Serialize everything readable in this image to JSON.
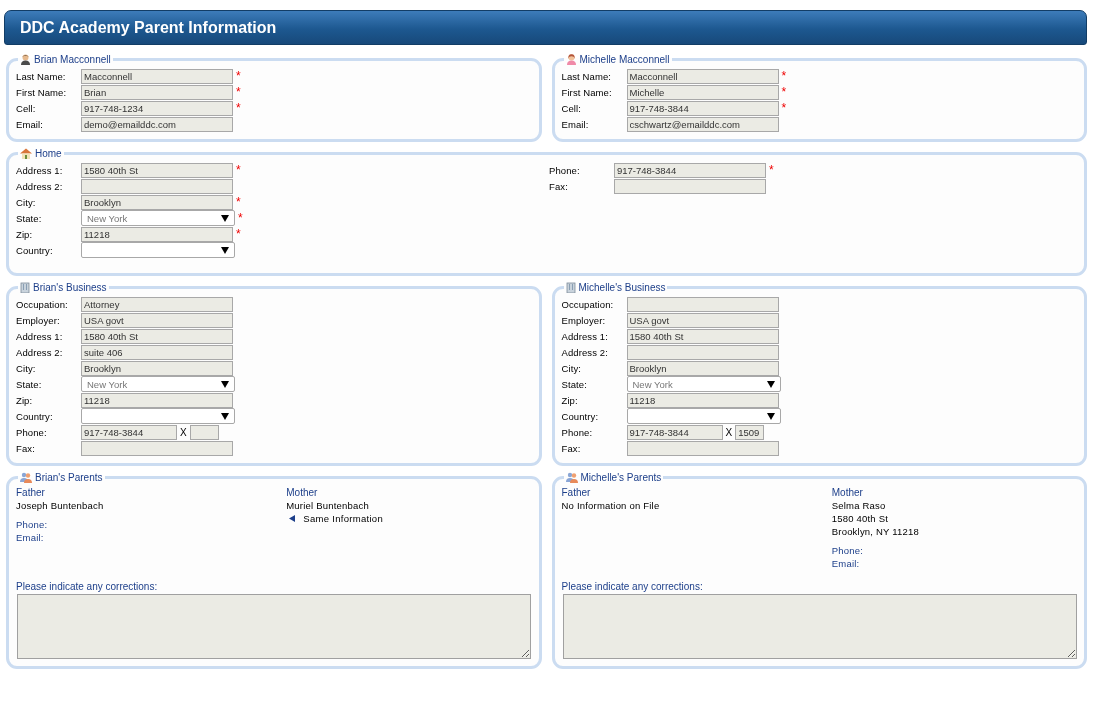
{
  "header": {
    "title": "DDC Academy Parent Information"
  },
  "people": [
    {
      "title": "Brian Macconnell",
      "fields": [
        {
          "kind": "text",
          "label": "Last Name:",
          "value": "Macconnell",
          "required_mark": "*"
        },
        {
          "kind": "text",
          "label": "First Name:",
          "value": "Brian",
          "required_mark": "*"
        },
        {
          "kind": "text",
          "label": "Cell:",
          "value": "917-748-1234",
          "required_mark": "*"
        },
        {
          "kind": "text",
          "label": "Email:",
          "value": "demo@emailddc.com"
        }
      ]
    },
    {
      "title": "Michelle Macconnell",
      "fields": [
        {
          "kind": "text",
          "label": "Last Name:",
          "value": "Macconnell",
          "required_mark": "*"
        },
        {
          "kind": "text",
          "label": "First Name:",
          "value": "Michelle",
          "required_mark": "*"
        },
        {
          "kind": "text",
          "label": "Cell:",
          "value": "917-748-3844",
          "required_mark": "*"
        },
        {
          "kind": "text",
          "label": "Email:",
          "value": "cschwartz@emailddc.com"
        }
      ]
    }
  ],
  "home": {
    "title": "Home",
    "left_fields": [
      {
        "kind": "text",
        "label": "Address 1:",
        "value": "1580 40th St",
        "required_mark": "*"
      },
      {
        "kind": "text",
        "label": "Address 2:"
      },
      {
        "kind": "text",
        "label": "City:",
        "value": "Brooklyn",
        "required_mark": "*"
      },
      {
        "kind": "select",
        "label": "State:",
        "value": "New York",
        "required_mark": "*"
      },
      {
        "kind": "text",
        "label": "Zip:",
        "value": "11218",
        "required_mark": "*"
      },
      {
        "kind": "select",
        "label": "Country:"
      }
    ],
    "right_fields": [
      {
        "kind": "text",
        "label": "Phone:",
        "value": "917-748-3844",
        "required_mark": "*"
      },
      {
        "kind": "text",
        "label": "Fax:"
      }
    ]
  },
  "businesses": [
    {
      "title": "Brian's Business",
      "fields": [
        {
          "kind": "text",
          "label": "Occupation:",
          "value": "Attorney"
        },
        {
          "kind": "text",
          "label": "Employer:",
          "value": "USA govt"
        },
        {
          "kind": "text",
          "label": "Address 1:",
          "value": "1580 40th St"
        },
        {
          "kind": "text",
          "label": "Address 2:",
          "value": "suite 406"
        },
        {
          "kind": "text",
          "label": "City:",
          "value": "Brooklyn"
        },
        {
          "kind": "select",
          "label": "State:",
          "value": "New York"
        },
        {
          "kind": "text",
          "label": "Zip:",
          "value": "11218"
        },
        {
          "kind": "select",
          "label": "Country:"
        },
        {
          "kind": "phone",
          "label": "Phone:",
          "value": "917-748-3844",
          "ext_label": "X"
        },
        {
          "kind": "text",
          "label": "Fax:"
        }
      ]
    },
    {
      "title": "Michelle's Business",
      "fields": [
        {
          "kind": "text",
          "label": "Occupation:"
        },
        {
          "kind": "text",
          "label": "Employer:",
          "value": "USA govt"
        },
        {
          "kind": "text",
          "label": "Address 1:",
          "value": "1580 40th St"
        },
        {
          "kind": "text",
          "label": "Address 2:"
        },
        {
          "kind": "text",
          "label": "City:",
          "value": "Brooklyn"
        },
        {
          "kind": "select",
          "label": "State:",
          "value": "New York"
        },
        {
          "kind": "text",
          "label": "Zip:",
          "value": "11218"
        },
        {
          "kind": "select",
          "label": "Country:"
        },
        {
          "kind": "phone",
          "label": "Phone:",
          "value": "917-748-3844",
          "ext_label": "X",
          "ext": "1509"
        },
        {
          "kind": "text",
          "label": "Fax:"
        }
      ]
    }
  ],
  "parents": [
    {
      "title": "Brian's Parents",
      "father": {
        "heading": "Father",
        "lines": [
          "Joseph Buntenbach"
        ],
        "contact_labels": [
          "Phone:",
          "Email:"
        ]
      },
      "mother": {
        "heading": "Mother",
        "lines": [
          "Muriel Buntenbach"
        ],
        "link": "Same Information"
      },
      "corrections_label": "Please indicate any corrections:"
    },
    {
      "title": "Michelle's Parents",
      "father": {
        "heading": "Father",
        "lines": [
          "No Information on File"
        ]
      },
      "mother": {
        "heading": "Mother",
        "lines": [
          "Selma Raso",
          "1580 40th St",
          "Brooklyn, NY 11218"
        ],
        "contact_labels": [
          "Phone:",
          "Email:"
        ]
      },
      "corrections_label": "Please indicate any corrections:"
    }
  ]
}
